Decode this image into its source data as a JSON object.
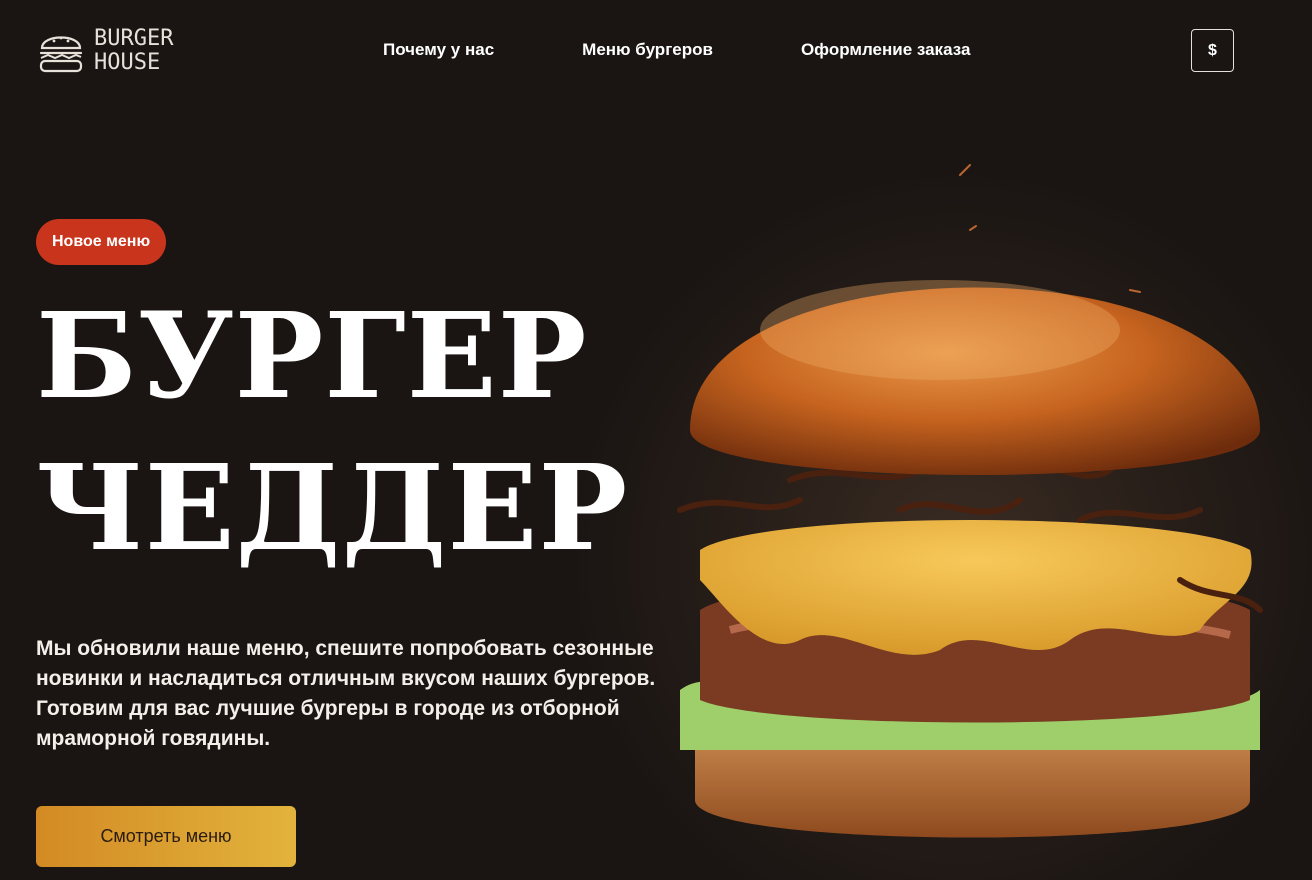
{
  "brand": {
    "line1": "BURGER",
    "line2": "HOUSE"
  },
  "nav": {
    "items": [
      {
        "label": "Почему у нас"
      },
      {
        "label": "Меню бургеров"
      },
      {
        "label": "Оформление заказа"
      }
    ]
  },
  "currency": {
    "label": "$"
  },
  "hero": {
    "badge": "Новое меню",
    "title_line1": "БУРГЕР",
    "title_line2": "ЧЕДДЕР",
    "description": "Мы обновили наше меню, спешите попробовать сезонные новинки и насладиться отличным вкусом наших бургеров. Готовим для вас лучшие бургеры в городе из отборной мраморной говядины.",
    "cta_label": "Смотреть меню"
  },
  "colors": {
    "background": "#1a1513",
    "badge": "#c9351c",
    "cta_start": "#d38a24",
    "cta_end": "#e2b33c"
  },
  "icons": {
    "logo": "burger-icon"
  }
}
